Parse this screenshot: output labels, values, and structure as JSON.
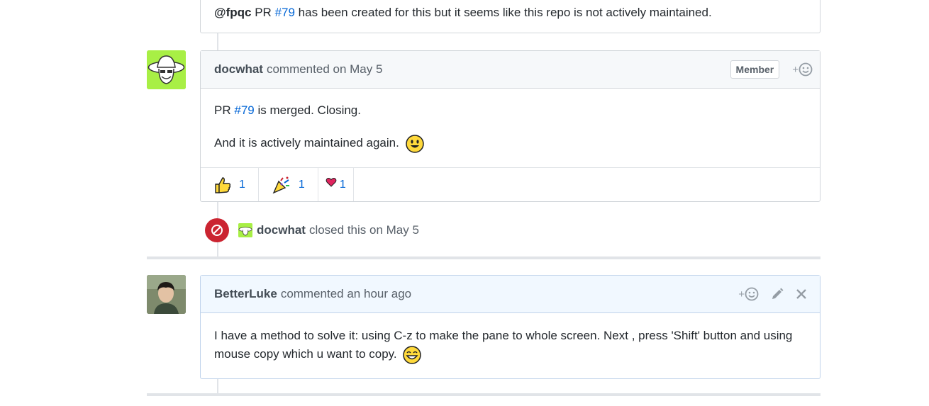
{
  "top_comment": {
    "mention": "@fpqc",
    "text_before": "PR",
    "pr_link": "#79",
    "text_after": "has been created for this but it seems like this repo is not actively maintained."
  },
  "comment_docwhat": {
    "author": "docwhat",
    "meta": "commented on May 5",
    "badge": "Member",
    "body_line1_prefix": "PR",
    "body_line1_link": "#79",
    "body_line1_suffix": "is merged. Closing.",
    "body_line2": "And it is actively maintained again.",
    "reactions": [
      {
        "icon": "thumbs-up-icon",
        "count": "1"
      },
      {
        "icon": "tada-icon",
        "count": "1"
      },
      {
        "icon": "heart-icon",
        "count": "1"
      }
    ]
  },
  "close_event": {
    "actor": "docwhat",
    "text": "closed this on May 5"
  },
  "comment_betterluke": {
    "author": "BetterLuke",
    "meta": "commented an hour ago",
    "body": "I have a method to solve it: using C-z to make the pane to whole screen. Next , press 'Shift' button and using mouse copy which u want to copy."
  },
  "colors": {
    "link": "#0366d6",
    "closed_red": "#cb2431",
    "avatar_green": "#a8ef45"
  }
}
